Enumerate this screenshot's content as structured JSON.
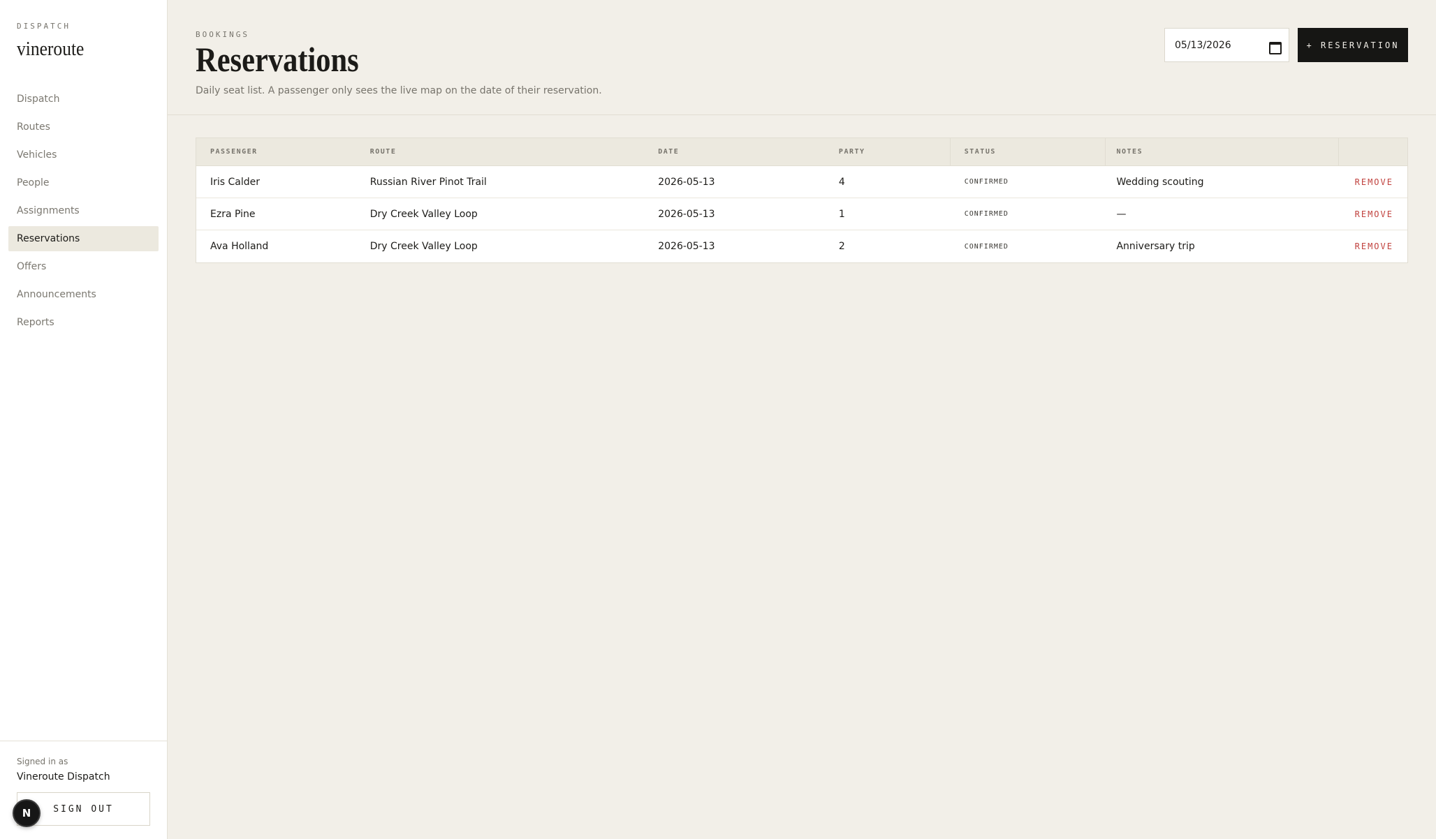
{
  "sidebar": {
    "eyebrow": "DISPATCH",
    "brand": "vineroute",
    "nav": [
      {
        "label": "Dispatch",
        "active": false
      },
      {
        "label": "Routes",
        "active": false
      },
      {
        "label": "Vehicles",
        "active": false
      },
      {
        "label": "People",
        "active": false
      },
      {
        "label": "Assignments",
        "active": false
      },
      {
        "label": "Reservations",
        "active": true
      },
      {
        "label": "Offers",
        "active": false
      },
      {
        "label": "Announcements",
        "active": false
      },
      {
        "label": "Reports",
        "active": false
      }
    ],
    "signed_in_label": "Signed in as",
    "signed_in_user": "Vineroute Dispatch",
    "sign_out_label": "SIGN OUT",
    "fab_letter": "N"
  },
  "header": {
    "eyebrow": "BOOKINGS",
    "title": "Reservations",
    "subtitle": "Daily seat list. A passenger only sees the live map on the date of their reservation.",
    "date_value": "05/13/2026",
    "add_button_label": "+ RESERVATION"
  },
  "table": {
    "columns": [
      "PASSENGER",
      "ROUTE",
      "DATE",
      "PARTY",
      "STATUS",
      "NOTES",
      ""
    ],
    "rows": [
      {
        "passenger": "Iris Calder",
        "route": "Russian River Pinot Trail",
        "date": "2026-05-13",
        "party": "4",
        "status": "CONFIRMED",
        "notes": "Wedding scouting",
        "action": "REMOVE"
      },
      {
        "passenger": "Ezra Pine",
        "route": "Dry Creek Valley Loop",
        "date": "2026-05-13",
        "party": "1",
        "status": "CONFIRMED",
        "notes": "—",
        "action": "REMOVE"
      },
      {
        "passenger": "Ava Holland",
        "route": "Dry Creek Valley Loop",
        "date": "2026-05-13",
        "party": "2",
        "status": "CONFIRMED",
        "notes": "Anniversary trip",
        "action": "REMOVE"
      }
    ]
  },
  "colors": {
    "background": "#f2efe8",
    "sidebar": "#ffffff",
    "accent_dark": "#161614",
    "danger": "#c0413d",
    "muted": "#77746c"
  }
}
